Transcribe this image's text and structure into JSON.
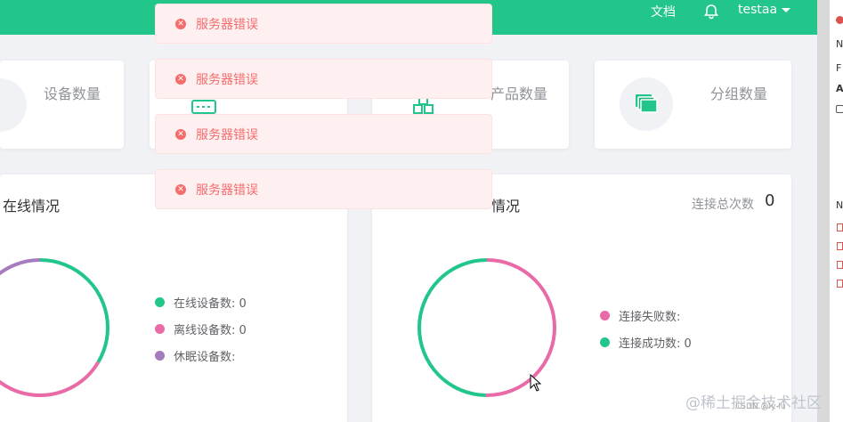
{
  "header": {
    "docs_label": "文档",
    "username": "testaa"
  },
  "stats": [
    {
      "label": "设备数量"
    },
    {
      "label": "产品数量"
    },
    {
      "label": "分组数量"
    }
  ],
  "online_panel": {
    "title": "在线情况",
    "legend": [
      {
        "label": "在线设备数: 0",
        "color": "#22c68a"
      },
      {
        "label": "离线设备数: 0",
        "color": "#e86aa6"
      },
      {
        "label": "休眠设备数:",
        "color": "#a57cbd"
      }
    ]
  },
  "connect_panel": {
    "title": "情况",
    "total_label": "连接总次数",
    "total_value": "0",
    "legend": [
      {
        "label": "连接失败数:",
        "color": "#e86aa6"
      },
      {
        "label": "连接成功数: 0",
        "color": "#22c68a"
      }
    ]
  },
  "toasts": [
    {
      "message": "服务器错误"
    },
    {
      "message": "服务器错误"
    },
    {
      "message": "服务器错误"
    },
    {
      "message": "服务器错误"
    }
  ],
  "devtools": {
    "items": [
      "N",
      "F",
      "A",
      "N"
    ]
  },
  "watermark": {
    "text": "@稀土掘金技术社区",
    "sub": "CSDN @ly-lu"
  }
}
